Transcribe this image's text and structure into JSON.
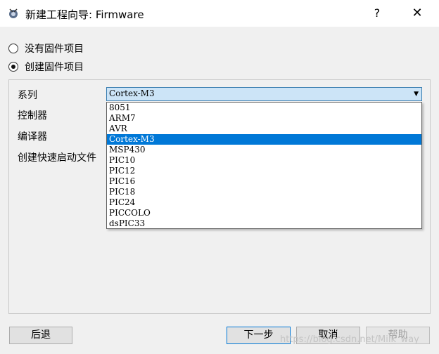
{
  "window": {
    "title": "新建工程向导: Firmware",
    "help_glyph": "?",
    "close_glyph": "✕"
  },
  "options": [
    {
      "label": "没有固件项目",
      "checked": false
    },
    {
      "label": "创建固件项目",
      "checked": true
    }
  ],
  "form": {
    "series_label": "系列",
    "controller_label": "控制器",
    "compiler_label": "编译器",
    "startup_label": "创建快速启动文件"
  },
  "combo": {
    "value": "Cortex-M3",
    "arrow": "▼",
    "items": [
      "8051",
      "ARM7",
      "AVR",
      "Cortex-M3",
      "MSP430",
      "PIC10",
      "PIC12",
      "PIC16",
      "PIC18",
      "PIC24",
      "PICCOLO",
      "dsPIC33"
    ],
    "selected_index": 3
  },
  "buttons": {
    "back": "后退",
    "next": "下一步",
    "cancel": "取消",
    "help": "帮助"
  },
  "watermark": "https://blog.csdn.net/Milk_way",
  "colors": {
    "selection": "#0078d7",
    "combo_focus": "#cce4f7"
  }
}
